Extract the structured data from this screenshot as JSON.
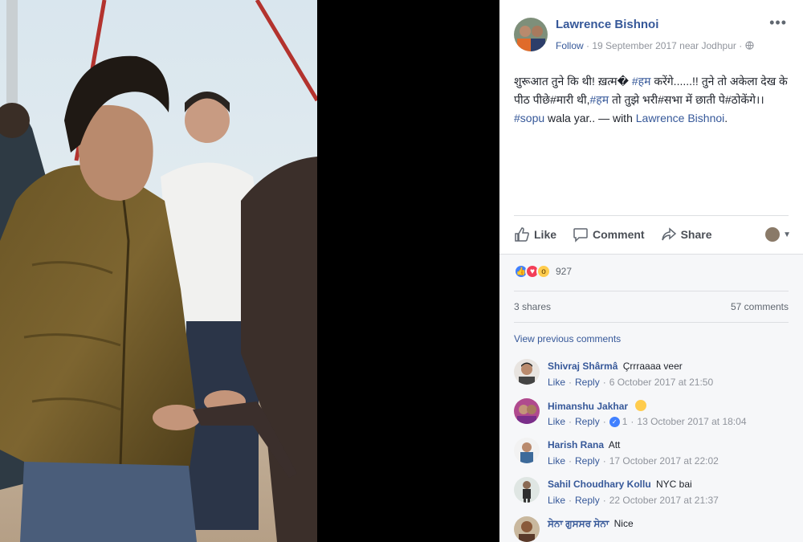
{
  "post": {
    "author": "Lawrence Bishnoi",
    "follow_label": "Follow",
    "date": "19 September 2017",
    "location": "near Jodhpur",
    "privacy_icon": "globe-icon",
    "more_icon": "more-options-icon",
    "text_part1": "शुरूआत तुने कि थी! ख़त्म� ",
    "hashtag1": "#हम",
    "text_part2": " करेंगे......!! तुने तो अकेला देख के पीठ पीछे#मारी थी,",
    "hashtag2": "#हम",
    "text_part3": " तो तुझे भरी#सभा में छाती पे#ठोकेंगे।।",
    "hashtag3": "#sopu",
    "text_part4": " wala yar.. — with ",
    "with_name": "Lawrence Bishnoi",
    "text_end": "."
  },
  "actions": {
    "like": "Like",
    "comment": "Comment",
    "share": "Share"
  },
  "stats": {
    "reaction_count": "927",
    "shares": "3 shares",
    "comments": "57 comments",
    "view_previous": "View previous comments"
  },
  "comments": [
    {
      "name": "Shivraj Shârmâ",
      "text": "Çrrraaaa veer",
      "like": "Like",
      "reply": "Reply",
      "likes": "",
      "time": "6 October 2017 at 21:50"
    },
    {
      "name": "Himanshu Jakhar",
      "text": "",
      "like": "Like",
      "reply": "Reply",
      "likes": "1",
      "time": "13 October 2017 at 18:04"
    },
    {
      "name": "Harish Rana",
      "text": "Att",
      "like": "Like",
      "reply": "Reply",
      "likes": "",
      "time": "17 October 2017 at 22:02"
    },
    {
      "name": "Sahil Choudhary Kollu",
      "text": "NYC bai",
      "like": "Like",
      "reply": "Reply",
      "likes": "",
      "time": "22 October 2017 at 21:37"
    },
    {
      "name": "ਸੇਨਾ ਗੁਸਸਰ ਸੇਨਾ",
      "text": "Nice",
      "like": "",
      "reply": "",
      "likes": "",
      "time": ""
    }
  ],
  "colors": {
    "link": "#365899",
    "meta": "#90949c",
    "like_blue": "#4080ff",
    "love_red": "#f33e58",
    "wow_yellow": "#ffcc4d"
  }
}
